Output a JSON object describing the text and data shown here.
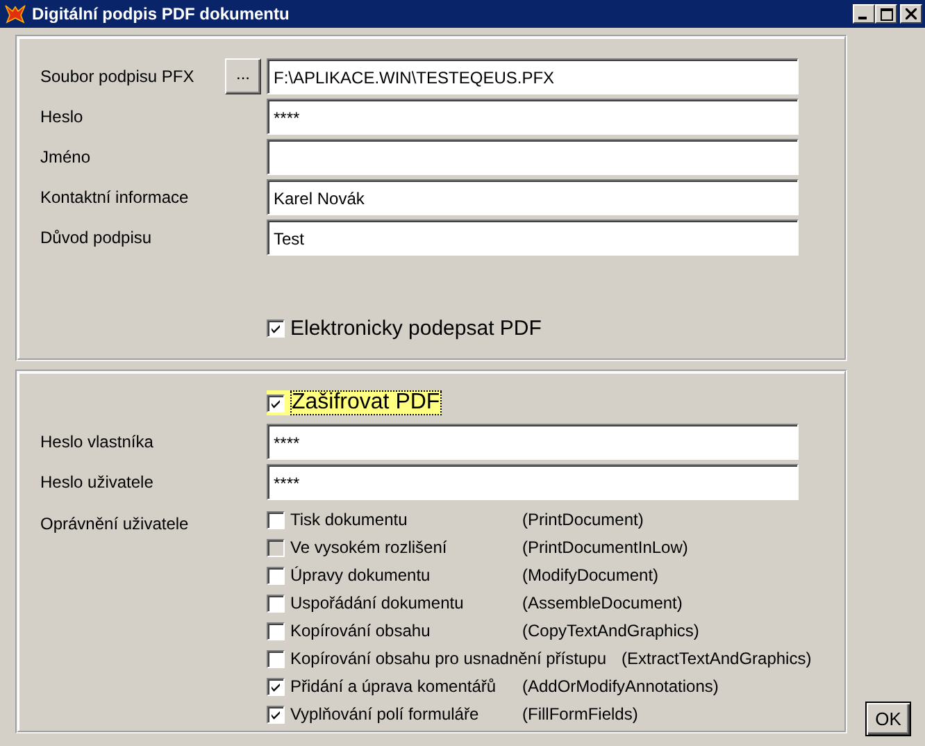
{
  "window": {
    "title": "Digitální podpis PDF dokumentu"
  },
  "signature": {
    "fields": [
      {
        "label": "Soubor podpisu PFX",
        "value": "F:\\APLIKACE.WIN\\TESTEQEUS.PFX",
        "browse_button": "..."
      },
      {
        "label": "Heslo",
        "value": "****"
      },
      {
        "label": "Jméno"
      },
      {
        "label": "Kontaktní informace",
        "value": "Karel Novák"
      },
      {
        "label": "Důvod podpisu",
        "value": "Test"
      }
    ],
    "sign_checkbox": {
      "label": "Elektronicky podepsat PDF",
      "checked": true
    }
  },
  "encryption": {
    "encrypt_checkbox": {
      "label": "Zašifrovat PDF",
      "checked": true,
      "focused": true
    },
    "fields": [
      {
        "label": "Heslo vlastníka",
        "value": "****"
      },
      {
        "label": "Heslo uživatele",
        "value": "****"
      }
    ],
    "permissions_label": "Oprávnění uživatele",
    "permissions": [
      {
        "label": "Tisk dokumentu",
        "code": "(PrintDocument)",
        "checked": false,
        "disabled": false
      },
      {
        "label": "Ve vysokém rozlišení",
        "code": "(PrintDocumentInLow)",
        "checked": false,
        "disabled": true
      },
      {
        "label": "Úpravy dokumentu",
        "code": "(ModifyDocument)",
        "checked": false,
        "disabled": false
      },
      {
        "label": "Uspořádání dokumentu",
        "code": "(AssembleDocument)",
        "checked": false,
        "disabled": false
      },
      {
        "label": "Kopírování obsahu",
        "code": "(CopyTextAndGraphics)",
        "checked": false,
        "disabled": false
      },
      {
        "label": "Kopírování obsahu pro usnadnění přístupu",
        "code": "(ExtractTextAndGraphics)",
        "checked": false,
        "disabled": false
      },
      {
        "label": "Přidání a úprava komentářů",
        "code": "(AddOrModifyAnnotations)",
        "checked": true,
        "disabled": false
      },
      {
        "label": "Vyplňování polí formuláře",
        "code": "(FillFormFields)",
        "checked": true,
        "disabled": false
      }
    ]
  },
  "ok_button": "OK"
}
